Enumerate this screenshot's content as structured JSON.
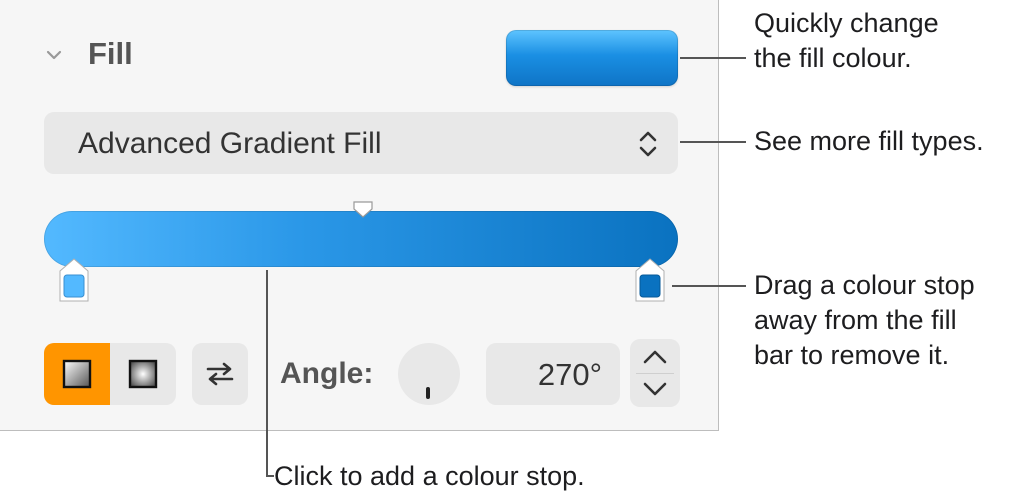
{
  "fill_panel": {
    "section_title": "Fill",
    "fill_color": "#1a8fe3",
    "fill_type_popup": "Advanced Gradient Fill",
    "gradient": {
      "start_color": "#53b9ff",
      "end_color": "#0a72c0",
      "stops": [
        {
          "color": "#53b9ff"
        },
        {
          "color": "#0a72c0"
        }
      ]
    },
    "gradient_type_buttons": [
      "linear",
      "radial"
    ],
    "angle_label": "Angle:",
    "angle_value": "270°",
    "accent_color": "#ff9500"
  },
  "callouts": {
    "fill_colour": [
      "Quickly change",
      "the fill colour."
    ],
    "fill_types": [
      "See more fill types."
    ],
    "remove_stop": [
      "Drag a colour stop",
      "away from the fill",
      "bar to remove it."
    ],
    "add_stop": [
      "Click to add a colour stop."
    ]
  },
  "icons": {
    "disclosure": "chevron-down-icon",
    "popup": "up-down-chevron-icon",
    "swap": "swap-arrows-icon",
    "step_up": "chevron-up-icon",
    "step_down": "chevron-down-icon"
  }
}
